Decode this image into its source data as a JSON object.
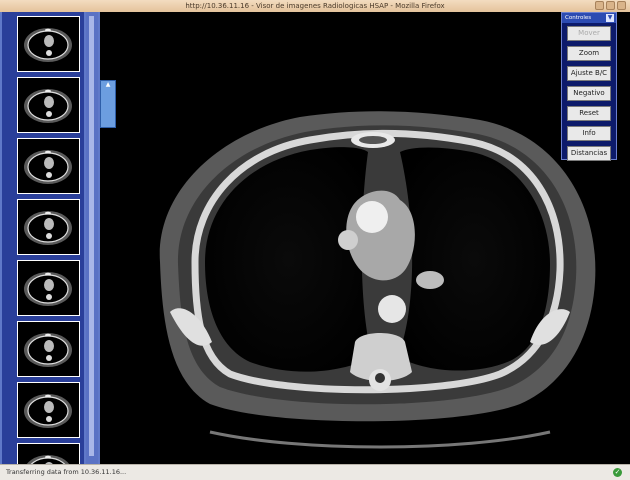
{
  "window": {
    "title": "http://10.36.11.16 - Visor de imagenes Radiologicas HSAP - Mozilla Firefox"
  },
  "icons": {
    "window_minimize": "minimize-icon",
    "window_maximize": "maximize-icon",
    "window_close": "close-icon",
    "collapse": "chevron-down-icon",
    "status": "check-icon"
  },
  "thumbnails": {
    "count": 8
  },
  "controls": {
    "title": "Controles",
    "buttons": [
      "Mover",
      "Zoom",
      "Ajuste B/C",
      "Negativo",
      "Reset",
      "Info",
      "Distancias"
    ],
    "disabled_button": "Mover",
    "collapse_glyph": "▼"
  },
  "status": {
    "text": "Transferring data from 10.36.11.16...",
    "check_glyph": "✓"
  },
  "colors": {
    "thumbstrip": "#2a3f9a",
    "controls_panel": "#0c1a6a",
    "titlebar": "#e4c39b"
  }
}
